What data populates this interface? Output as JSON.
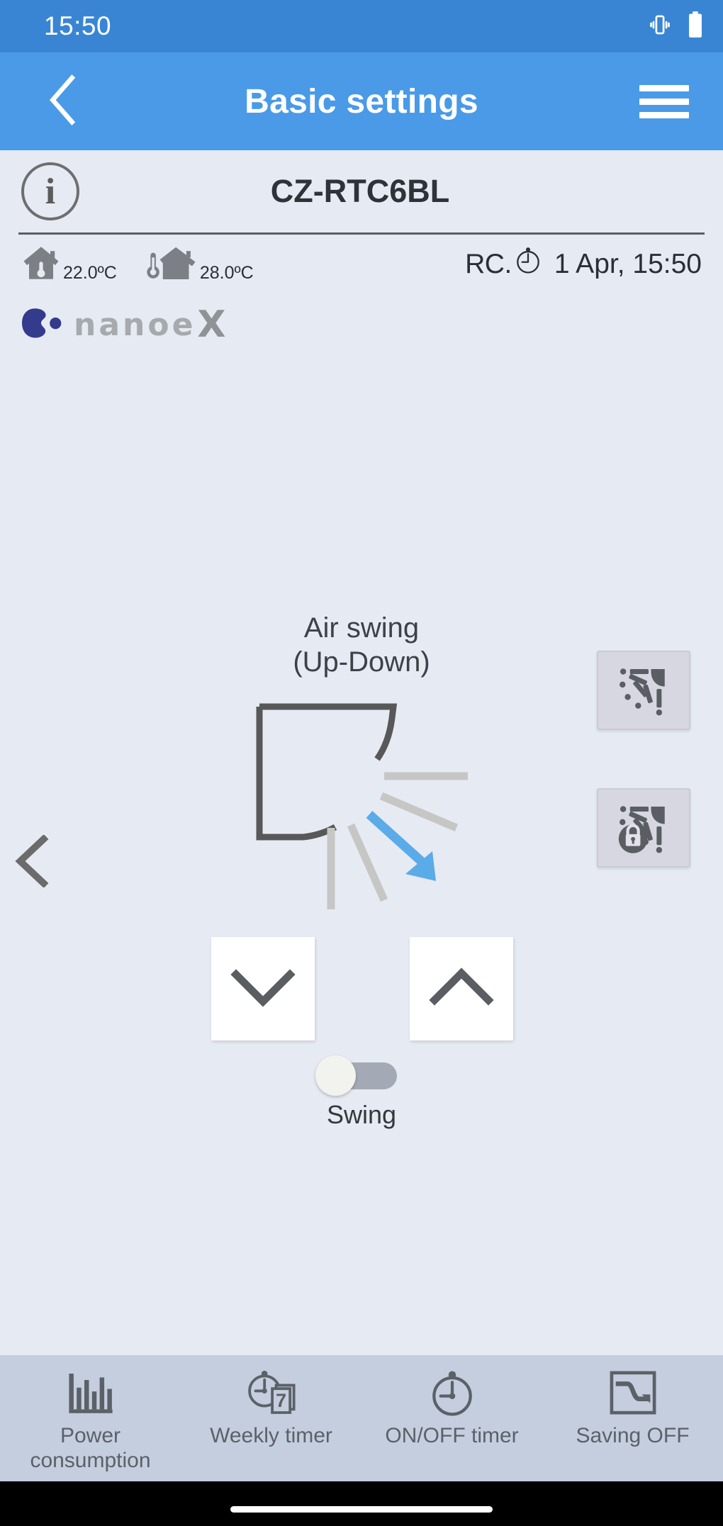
{
  "colors": {
    "status_bar": "#3a85d3",
    "nav_bar": "#4a9ae8",
    "page_background": "#e6eaf3",
    "tab_bar": "#c4cedf",
    "accent_blue": "#5aabe8",
    "icon_gray": "#5c6167",
    "ray_gray": "#c6c6c4",
    "nanoe_blue": "#343a8c",
    "toggle_track": "#a4a9b6",
    "toggle_knob": "#f2f2ef"
  },
  "status_bar": {
    "time": "15:50",
    "icons": [
      "vibrate-icon",
      "battery-icon"
    ]
  },
  "nav_bar": {
    "back_icon": "chevron-left-icon",
    "title": "Basic settings",
    "menu_icon": "hamburger-menu-icon"
  },
  "device": {
    "info_icon": "info-icon",
    "info_glyph": "i",
    "name": "CZ-RTC6BL",
    "indoor": {
      "icon": "house-thermometer-icon",
      "value": "22.0ºC"
    },
    "outdoor": {
      "icon": "thermometer-house-icon",
      "value": "28.0ºC"
    },
    "rc": {
      "label": "RC.",
      "clock_icon": "clock-icon",
      "datetime": "1 Apr, 15:50"
    },
    "nanoe": {
      "logo_icon": "nanoe-blob-icon",
      "word": "nanoe",
      "x": "X"
    }
  },
  "main": {
    "prev_icon": "chevron-left-icon",
    "title_line1": "Air swing",
    "title_line2": "(Up-Down)",
    "illustration": "air-swing-up-down-illustration",
    "side_buttons": [
      {
        "name": "swing-direction-button",
        "icon": "air-swing-rays-icon",
        "locked": false
      },
      {
        "name": "swing-lock-button",
        "icon": "air-swing-rays-lock-icon",
        "locked": true
      }
    ],
    "down_button": {
      "icon": "chevron-down-icon",
      "label": ""
    },
    "up_button": {
      "icon": "chevron-up-icon",
      "label": ""
    },
    "swing_toggle": {
      "label": "Swing",
      "state": "off"
    }
  },
  "tab_bar": {
    "items": [
      {
        "icon": "bar-chart-icon",
        "label_line1": "Power",
        "label_line2": "consumption"
      },
      {
        "icon": "weekly-timer-icon",
        "label_line1": "Weekly timer",
        "label_line2": ""
      },
      {
        "icon": "clock-icon",
        "label_line1": "ON/OFF timer",
        "label_line2": ""
      },
      {
        "icon": "saving-graph-icon",
        "label_line1": "Saving OFF",
        "label_line2": ""
      }
    ]
  }
}
